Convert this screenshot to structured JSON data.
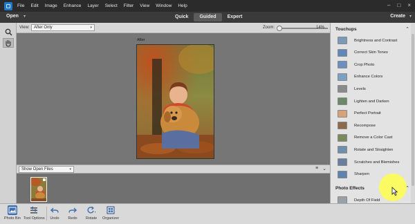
{
  "menubar": {
    "items": [
      "File",
      "Edit",
      "Image",
      "Enhance",
      "Layer",
      "Select",
      "Filter",
      "View",
      "Window",
      "Help"
    ],
    "minimize": "–",
    "maximize": "□",
    "close": "×"
  },
  "modebar": {
    "open_label": "Open",
    "modes": [
      "Quick",
      "Guided",
      "Expert"
    ],
    "active_mode": "Guided",
    "create_label": "Create"
  },
  "viewbar": {
    "view_label": "View:",
    "view_value": "After Only",
    "zoom_label": "Zoom:",
    "zoom_value": "14%"
  },
  "canvas": {
    "after_label": "After"
  },
  "binbar": {
    "source_value": "Show Open Files"
  },
  "panel": {
    "touchups_title": "Touchups",
    "touchups": [
      {
        "label": "Brightness and Contrast",
        "icon": "brightness-contrast-icon"
      },
      {
        "label": "Correct Skin Tones",
        "icon": "skin-tones-icon"
      },
      {
        "label": "Crop Photo",
        "icon": "crop-photo-icon"
      },
      {
        "label": "Enhance Colors",
        "icon": "enhance-colors-icon"
      },
      {
        "label": "Levels",
        "icon": "levels-icon"
      },
      {
        "label": "Lighten and Darken",
        "icon": "lighten-darken-icon"
      },
      {
        "label": "Perfect Portrait",
        "icon": "perfect-portrait-icon"
      },
      {
        "label": "Recompose",
        "icon": "recompose-icon"
      },
      {
        "label": "Remove a Color Cast",
        "icon": "color-cast-icon"
      },
      {
        "label": "Rotate and Straighten",
        "icon": "rotate-straighten-icon"
      },
      {
        "label": "Scratches and Blemishes",
        "icon": "scratches-icon"
      },
      {
        "label": "Sharpen",
        "icon": "sharpen-icon"
      }
    ],
    "effects_title": "Photo Effects",
    "effects": [
      {
        "label": "Depth Of Field",
        "icon": "depth-of-field-icon"
      }
    ]
  },
  "taskbar": {
    "items": [
      {
        "label": "Photo Bin",
        "icon": "photo-bin-icon",
        "active": true
      },
      {
        "label": "Tool Options",
        "icon": "tool-options-icon"
      },
      {
        "label": "Undo",
        "icon": "undo-icon"
      },
      {
        "label": "Redo",
        "icon": "redo-icon"
      },
      {
        "label": "Rotate",
        "icon": "rotate-icon"
      },
      {
        "label": "Organizer",
        "icon": "organizer-icon"
      }
    ]
  },
  "colors": {
    "menubar_bg": "#2b2b2b",
    "modebar_bg": "#3a3a3a",
    "canvas_bg": "#767676",
    "panel_bg": "#e3e3e3",
    "accent_blue": "#3d6fb0",
    "highlight_yellow": "#ffff46"
  }
}
